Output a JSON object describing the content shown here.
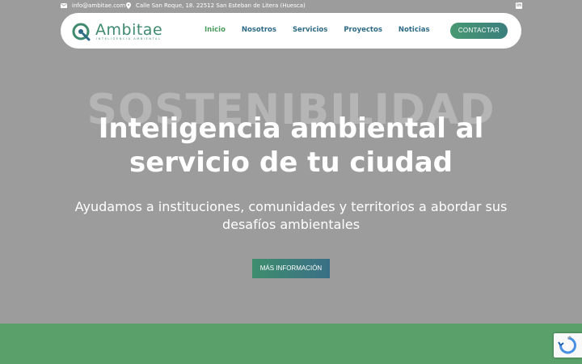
{
  "topbar": {
    "email": "info@ambitae.com",
    "address": "Calle San Roque, 18. 22512 San Esteban de Litera (Huesca)",
    "linkedin_icon": "linkedin-icon"
  },
  "brand": {
    "name": "Ambitae",
    "tagline": "INTELIGENCIA AMBIENTAL"
  },
  "nav": {
    "items": [
      {
        "label": "Inicio"
      },
      {
        "label": "Nosotros"
      },
      {
        "label": "Servicios"
      },
      {
        "label": "Proyectos"
      },
      {
        "label": "Noticias"
      }
    ],
    "contact_label": "CONTACTAR"
  },
  "hero": {
    "background_word": "SOSTENIBILIDAD",
    "title": "Inteligencia ambiental al servicio de tu ciudad",
    "subtitle": "Ayudamos a instituciones, comunidades y territorios a abordar sus desafíos ambientales",
    "button_label": "MÁS INFORMACIÓN"
  },
  "colors": {
    "accent_green": "#4a9a5c",
    "accent_blue": "#2e6a86",
    "hero_overlay": "#9c9c9c",
    "band_green": "#5aa06a"
  }
}
